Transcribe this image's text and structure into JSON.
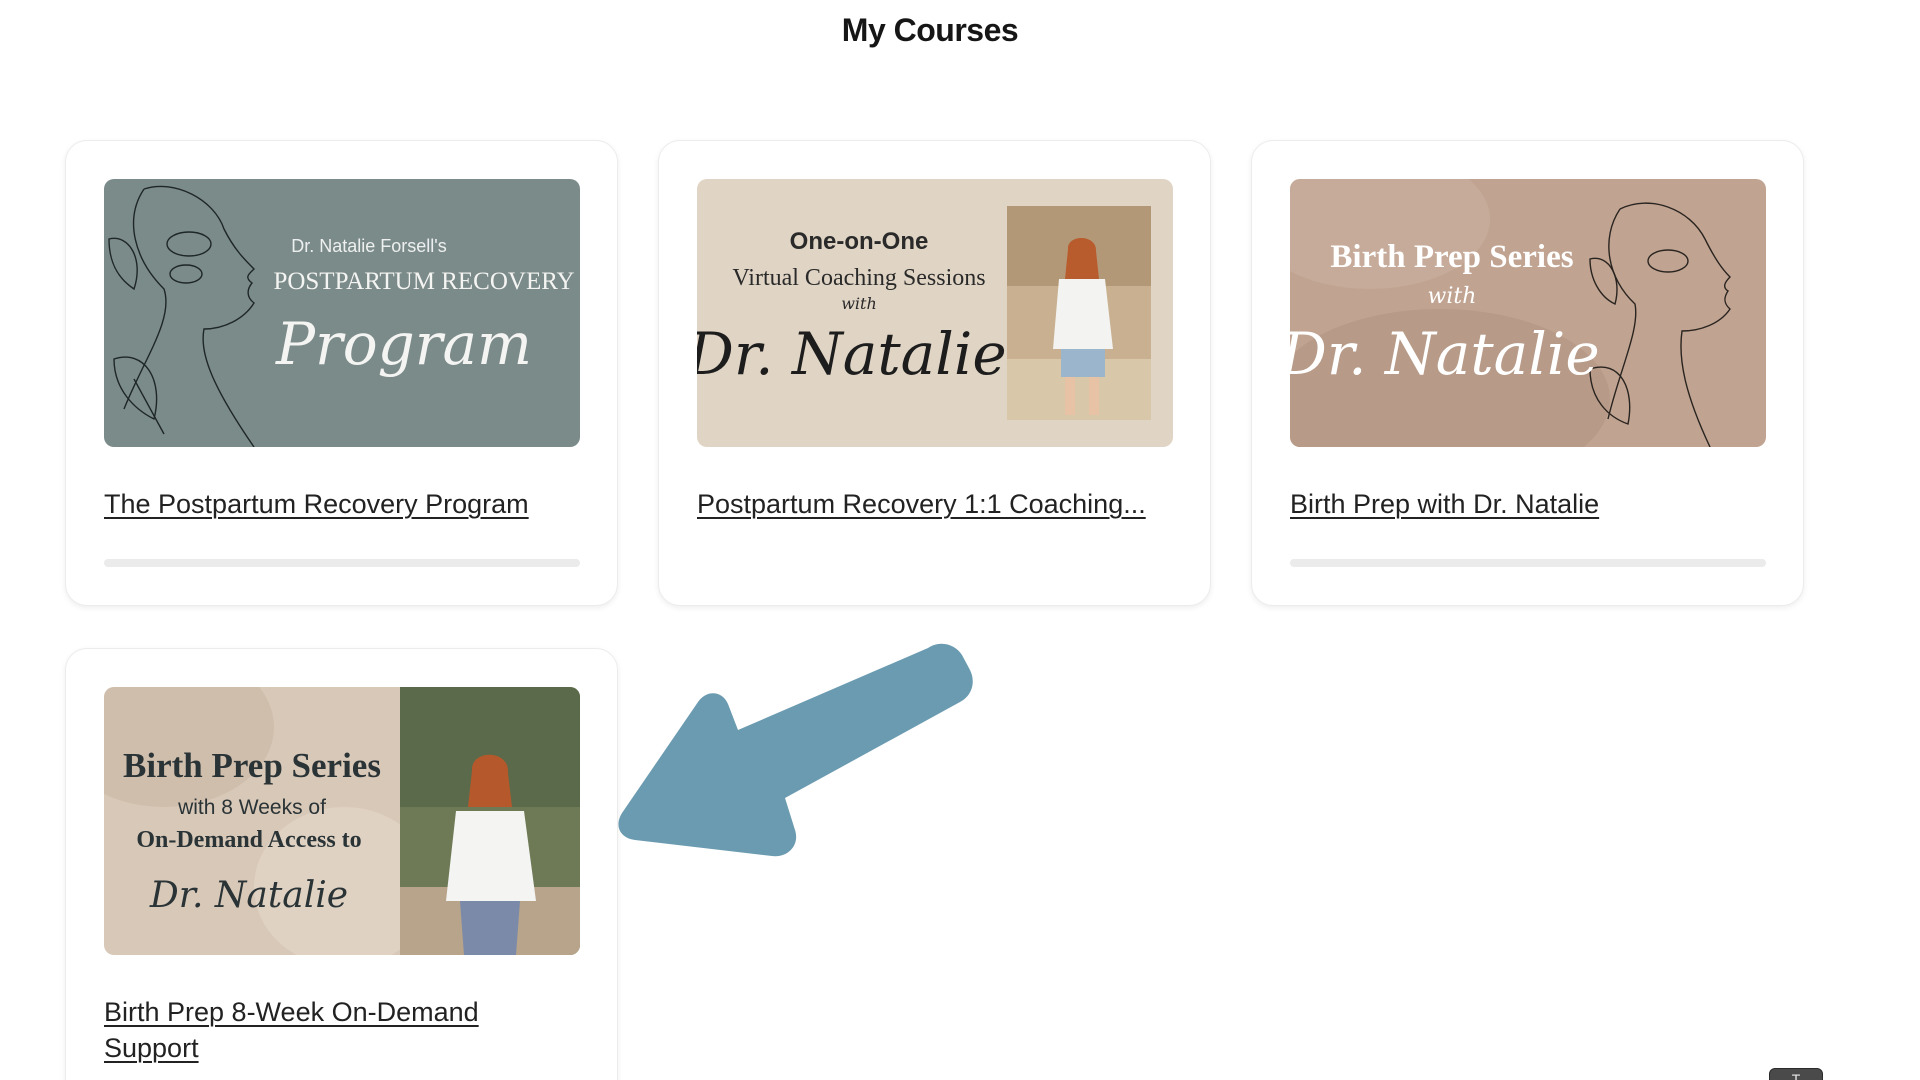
{
  "page": {
    "title": "My Courses"
  },
  "colors": {
    "accent_arrow": "#6b9bb0",
    "thumb_sage": "#7b8b8a",
    "thumb_beige": "#e0d4c4",
    "thumb_tan": "#c0a491",
    "thumb_sand": "#d8c8b8"
  },
  "courses": [
    {
      "title": "The Postpartum Recovery Program",
      "progress": 0,
      "thumb": {
        "line1": "Dr. Natalie Forsell's",
        "line2": "POSTPARTUM RECOVERY",
        "line3": "Program",
        "art_icon": "line-art-face-icon"
      }
    },
    {
      "title": "Postpartum Recovery 1:1 Coaching...",
      "thumb": {
        "line1": "One-on-One",
        "line2": "Virtual Coaching Sessions",
        "line3": "with",
        "line4": "Dr. Natalie",
        "photo": "photo-of-instructor"
      }
    },
    {
      "title": "Birth Prep with Dr. Natalie",
      "progress": 0,
      "thumb": {
        "line1": "Birth Prep Series",
        "line2": "with",
        "line3": "Dr. Natalie",
        "art_icon": "line-art-face-icon"
      }
    },
    {
      "title": "Birth Prep 8-Week On-Demand Support",
      "thumb": {
        "line1": "Birth Prep Series",
        "line2": "with 8 Weeks of",
        "line3": "On-Demand Access to",
        "line4": "Dr. Natalie",
        "photo": "photo-of-instructor"
      }
    }
  ],
  "annotation": {
    "icon": "pointer-arrow-icon"
  },
  "widget": {
    "icon": "chat-widget-icon",
    "label": "T"
  }
}
